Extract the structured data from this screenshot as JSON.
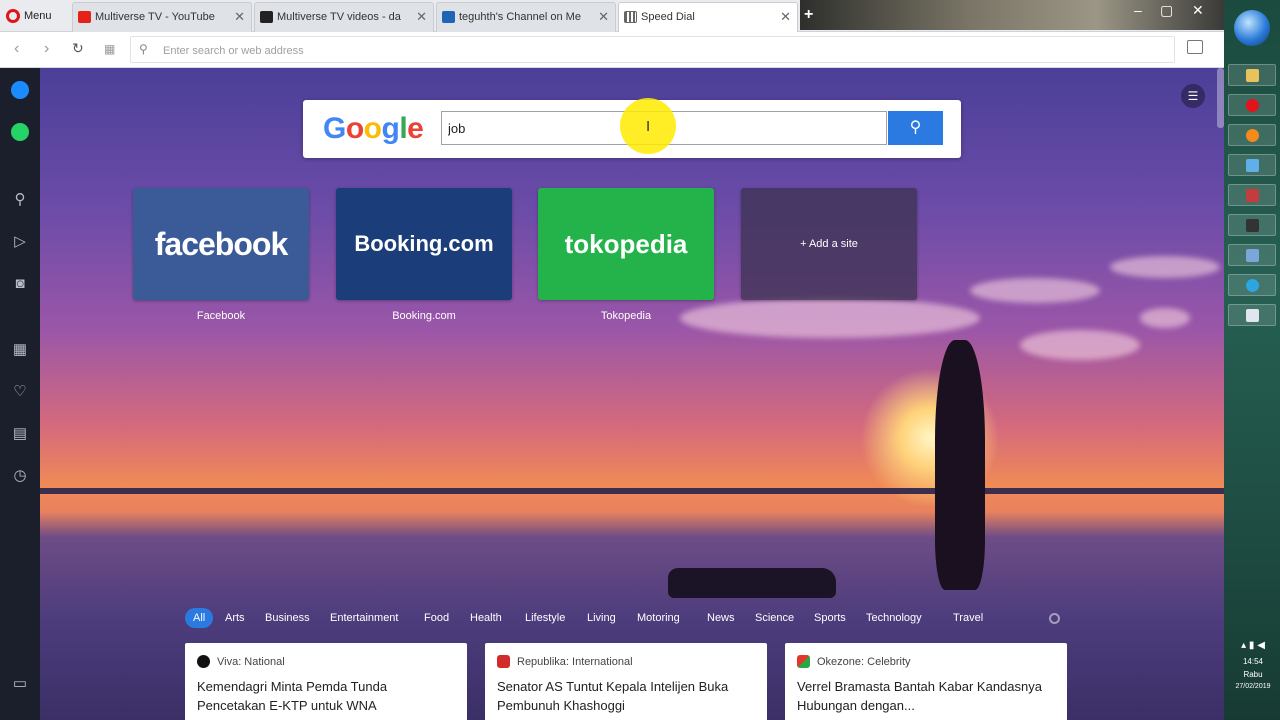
{
  "tabs": [
    {
      "label": "Menu"
    },
    {
      "label": "Multiverse TV - YouTube"
    },
    {
      "label": "Multiverse TV videos - da"
    },
    {
      "label": "teguhth's Channel on Me"
    },
    {
      "label": "Speed Dial"
    }
  ],
  "address": {
    "placeholder": "Enter search or web address"
  },
  "search": {
    "logo": "Google",
    "query": "job"
  },
  "speed_dial": [
    {
      "logo": "facebook",
      "label": "Facebook",
      "color": "#3b5b98"
    },
    {
      "logo": "Booking.com",
      "label": "Booking.com",
      "color": "#1b3d7a"
    },
    {
      "logo": "tokopedia",
      "label": "Tokopedia",
      "color": "#23b34a"
    },
    {
      "logo": "+ Add a site",
      "label": ""
    }
  ],
  "news": {
    "categories": [
      "All",
      "Arts",
      "Business",
      "Entertainment",
      "Food",
      "Health",
      "Lifestyle",
      "Living",
      "Motoring",
      "News",
      "Science",
      "Sports",
      "Technology",
      "Travel"
    ],
    "cards": [
      {
        "source": "Viva: National",
        "headline": "Kemendagri Minta Pemda Tunda Pencetakan E-KTP untuk WNA",
        "icon_color": "#111111"
      },
      {
        "source": "Republika: International",
        "headline": "Senator AS Tuntut Kepala Intelijen Buka Pembunuh Khashoggi",
        "icon_color": "#d22b2b"
      },
      {
        "source": "Okezone: Celebrity",
        "headline": "Verrel Bramasta Bantah Kabar Kandasnya Hubungan dengan...",
        "icon_color": "#e0392b"
      }
    ]
  },
  "tray": {
    "time": "14:54",
    "day": "Rabu",
    "date": "27/02/2019"
  },
  "colors": {
    "accent": "#2a7ae2",
    "sidebar": "#1b1f2b"
  }
}
